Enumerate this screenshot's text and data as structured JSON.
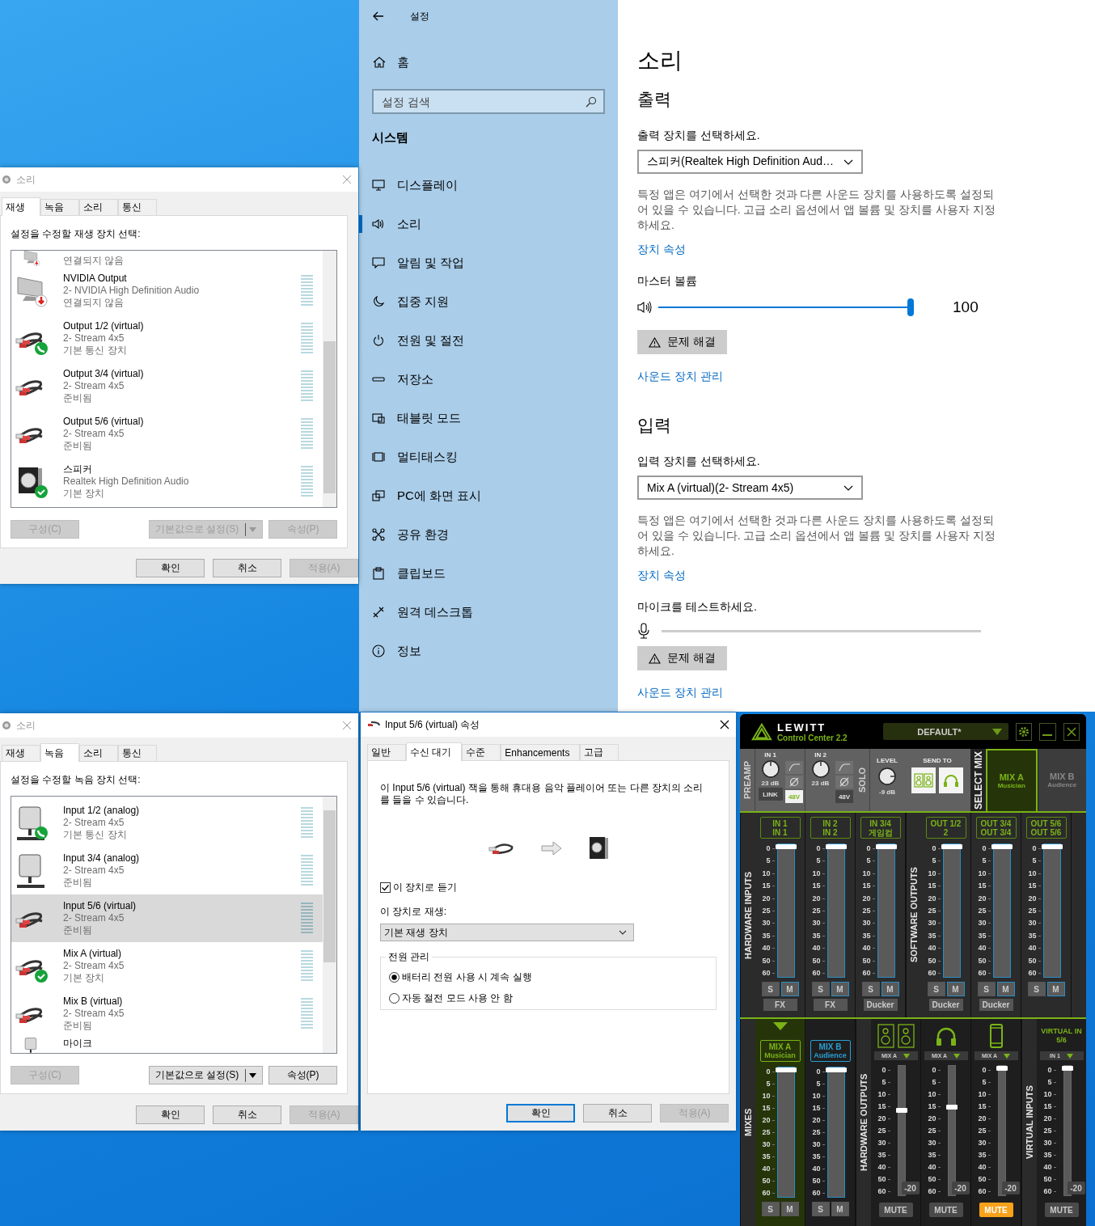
{
  "settings": {
    "title": "설정",
    "home": "홈",
    "search": {
      "placeholder": "설정 검색"
    },
    "section": "시스템",
    "nav": [
      {
        "kind": "display",
        "label": "디스플레이",
        "selected": false
      },
      {
        "kind": "sound",
        "label": "소리",
        "selected": true
      },
      {
        "kind": "notify",
        "label": "알림 및 작업",
        "selected": false
      },
      {
        "kind": "focus",
        "label": "집중 지원",
        "selected": false
      },
      {
        "kind": "power",
        "label": "전원 및 절전",
        "selected": false
      },
      {
        "kind": "storage",
        "label": "저장소",
        "selected": false
      },
      {
        "kind": "tablet",
        "label": "태블릿 모드",
        "selected": false
      },
      {
        "kind": "multitask",
        "label": "멀티태스킹",
        "selected": false
      },
      {
        "kind": "project",
        "label": "PC에 화면 표시",
        "selected": false
      },
      {
        "kind": "share",
        "label": "공유 환경",
        "selected": false
      },
      {
        "kind": "clipboard",
        "label": "클립보드",
        "selected": false
      },
      {
        "kind": "remote",
        "label": "원격 데스크톱",
        "selected": false
      },
      {
        "kind": "info",
        "label": "정보",
        "selected": false
      }
    ],
    "page_title": "소리",
    "sections": [
      {
        "kind": "output",
        "heading": "출력",
        "select_label": "출력 장치를 선택하세요.",
        "device": "스피커(Realtek High Definition Aud…",
        "note": "특정 앱은 여기에서 선택한 것과 다른 사운드 장치를 사용하도록 설정되어 있을 수 있습니다. 고급 소리 옵션에서 앱 볼륨 및 장치를 사용자 지정하세요.",
        "link": "장치 속성",
        "meter_label": "마스터 볼륨",
        "level": 1,
        "reading": "100",
        "troubleshoot": "문제 해결",
        "manage": "사운드 장치 관리"
      },
      {
        "kind": "input",
        "heading": "입력",
        "select_label": "입력 장치를 선택하세요.",
        "device": "Mix A (virtual)(2- Stream 4x5)",
        "note": "특정 앱은 여기에서 선택한 것과 다른 사운드 장치를 사용하도록 설정되어 있을 수 있습니다. 고급 소리 옵션에서 앱 볼륨 및 장치를 사용자 지정하세요.",
        "link": "장치 속성",
        "meter_label": "마이크를 테스트하세요.",
        "level": 0,
        "troubleshoot": "문제 해결",
        "manage": "사운드 장치 관리"
      }
    ]
  },
  "sound_dialogs": [
    {
      "title": "소리",
      "tabs": [
        {
          "label": "재생",
          "selected": true
        },
        {
          "label": "녹음",
          "selected": false
        },
        {
          "label": "소리",
          "selected": false
        },
        {
          "label": "통신",
          "selected": false
        }
      ],
      "instruction": "설정을 수정할 재생 장치 선택:",
      "devices": [
        {
          "kind": "monitor_unplugged",
          "status": "연결되지 않음",
          "selected": false
        },
        {
          "kind": "monitor_unplugged",
          "name": "NVIDIA Output",
          "driver": "2- NVIDIA High Definition Audio",
          "status": "연결되지 않음",
          "selected": false
        },
        {
          "kind": "rca_communication",
          "name": "Output 1/2 (virtual)",
          "driver": "2- Stream 4x5",
          "status": "기본 통신 장치",
          "selected": false
        },
        {
          "kind": "rca",
          "name": "Output 3/4 (virtual)",
          "driver": "2- Stream 4x5",
          "status": "준비됨",
          "selected": false
        },
        {
          "kind": "rca",
          "name": "Output 5/6 (virtual)",
          "driver": "2- Stream 4x5",
          "status": "준비됨",
          "selected": false
        },
        {
          "kind": "speaker_default",
          "name": "스피커",
          "driver": "Realtek High Definition Audio",
          "status": "기본 장치",
          "selected": false
        }
      ],
      "buttons": [
        {
          "kind": "plain",
          "label": "구성(C)",
          "disabled": true
        },
        {
          "kind": "split",
          "label": "기본값으로 설정(S)",
          "disabled": true
        },
        {
          "kind": "plain",
          "label": "속성(P)",
          "disabled": true
        }
      ],
      "footer": [
        {
          "label": "확인",
          "disabled": false
        },
        {
          "label": "취소",
          "disabled": false
        },
        {
          "label": "적용(A)",
          "disabled": true
        }
      ]
    },
    {
      "title": "소리",
      "tabs": [
        {
          "label": "재생",
          "selected": false
        },
        {
          "label": "녹음",
          "selected": true
        },
        {
          "label": "소리",
          "selected": false
        },
        {
          "label": "통신",
          "selected": false
        }
      ],
      "instruction": "설정을 수정할 녹음 장치 선택:",
      "devices": [
        {
          "kind": "mic_communication",
          "name": "Input 1/2 (analog)",
          "driver": "2- Stream 4x5",
          "status": "기본 통신 장치",
          "selected": false
        },
        {
          "kind": "mic",
          "name": "Input 3/4 (analog)",
          "driver": "2- Stream 4x5",
          "status": "준비됨",
          "selected": false
        },
        {
          "kind": "rca",
          "name": "Input 5/6 (virtual)",
          "driver": "2- Stream 4x5",
          "status": "준비됨",
          "selected": true
        },
        {
          "kind": "rca_default",
          "name": "Mix A (virtual)",
          "driver": "2- Stream 4x5",
          "status": "기본 장치",
          "selected": false
        },
        {
          "kind": "rca",
          "name": "Mix B (virtual)",
          "driver": "2- Stream 4x5",
          "status": "준비됨",
          "selected": false
        },
        {
          "kind": "mic",
          "name": "마이크",
          "selected": false
        }
      ],
      "buttons": [
        {
          "kind": "plain",
          "label": "구성(C)",
          "disabled": true
        },
        {
          "kind": "split",
          "label": "기본값으로 설정(S)",
          "disabled": false
        },
        {
          "kind": "plain",
          "label": "속성(P)",
          "disabled": false
        }
      ],
      "footer": [
        {
          "label": "확인",
          "disabled": false
        },
        {
          "label": "취소",
          "disabled": false
        },
        {
          "label": "적용(A)",
          "disabled": true
        }
      ]
    }
  ],
  "properties": {
    "title": "Input 5/6 (virtual) 속성",
    "tabs": [
      {
        "label": "일반",
        "selected": false
      },
      {
        "label": "수신 대기",
        "selected": true
      },
      {
        "label": "수준",
        "selected": false
      },
      {
        "label": "Enhancements",
        "selected": false
      },
      {
        "label": "고급",
        "selected": false
      }
    ],
    "description": "이 Input 5/6 (virtual) 잭을 통해 휴대용 음악 플레이어 또는 다른 장치의 소리를 들을 수 있습니다.",
    "listen": {
      "label": "이 장치로 듣기",
      "checked": true
    },
    "play_label": "이 장치로 재생:",
    "play_device": "기본 재생 장치",
    "power": {
      "label": "전원 관리",
      "options": [
        {
          "label": "배터리 전원 사용 시 계속 실행",
          "selected": true
        },
        {
          "label": "자동 절전 모드 사용 안 함",
          "selected": false
        }
      ]
    },
    "buttons": [
      {
        "label": "확인",
        "default": true,
        "disabled": false
      },
      {
        "label": "취소",
        "default": false,
        "disabled": false
      },
      {
        "label": "적용(A)",
        "default": false,
        "disabled": true
      }
    ]
  },
  "mixer": {
    "brand": "LEWITT",
    "product": "Control Center 2.2",
    "preset": "DEFAULT*",
    "preamp": {
      "label": "PREAMP",
      "inputs": [
        {
          "name": "IN 1",
          "gain": "23 dB",
          "link": "LINK",
          "phantom": "48V",
          "phantom_on": true
        },
        {
          "name": "IN 2",
          "gain": "23 dB",
          "phantom": "48V",
          "phantom_on": false
        }
      ]
    },
    "solo": {
      "label": "SOLO",
      "level_label": "LEVEL",
      "level_reading": "-9 dB",
      "send_label": "SEND TO"
    },
    "select_mix": {
      "label": "SELECT MIX",
      "mixes": [
        {
          "name": "MIX A",
          "sub": "Musician",
          "selected": true
        },
        {
          "name": "MIX B",
          "sub": "Audience",
          "selected": false
        }
      ]
    },
    "upper_groups": [
      {
        "label": "HARDWARE INPUTS",
        "channels": [
          {
            "line1": "IN 1",
            "line2": "IN 1",
            "level": 1,
            "scale": [
              "0",
              "5",
              "10",
              "15",
              "20",
              "25",
              "30",
              "35",
              "40",
              "50",
              "60"
            ],
            "solo": "S",
            "mute": "M",
            "footer": "FX"
          },
          {
            "line1": "IN 2",
            "line2": "IN 2",
            "level": 1,
            "scale": [
              "0",
              "5",
              "10",
              "15",
              "20",
              "25",
              "30",
              "35",
              "40",
              "50",
              "60"
            ],
            "solo": "S",
            "mute": "M",
            "footer": "FX"
          },
          {
            "line1": "IN 3/4",
            "line2": "게임컴",
            "level": 1,
            "scale": [
              "0",
              "5",
              "10",
              "15",
              "20",
              "25",
              "30",
              "35",
              "40",
              "50",
              "60"
            ],
            "solo": "S",
            "mute": "M",
            "footer": "Ducker"
          }
        ]
      },
      {
        "label": "SOFTWARE OUTPUTS",
        "channels": [
          {
            "line1": "OUT 1/2",
            "line2": "2",
            "level": 1,
            "scale": [
              "0",
              "5",
              "10",
              "15",
              "20",
              "25",
              "30",
              "35",
              "40",
              "50",
              "60"
            ],
            "solo": "S",
            "mute": "M",
            "footer": "Ducker"
          },
          {
            "line1": "OUT 3/4",
            "line2": "OUT 3/4",
            "level": 1,
            "scale": [
              "0",
              "5",
              "10",
              "15",
              "20",
              "25",
              "30",
              "35",
              "40",
              "50",
              "60"
            ],
            "solo": "S",
            "mute": "M",
            "footer": "Ducker"
          },
          {
            "line1": "OUT 5/6",
            "line2": "OUT 5/6",
            "level": 1,
            "scale": [
              "0",
              "5",
              "10",
              "15",
              "20",
              "25",
              "30",
              "35",
              "40",
              "50",
              "60"
            ],
            "solo": "S",
            "mute": "M"
          }
        ]
      }
    ],
    "lower_groups": [
      {
        "label": "MIXES",
        "channels": [
          {
            "kind": "mix",
            "name": "MIX A",
            "sub": "Musician",
            "color": "#7ab317",
            "selected": true,
            "level": 1,
            "scale": [
              "0",
              "5",
              "10",
              "15",
              "20",
              "25",
              "30",
              "35",
              "40",
              "50",
              "60"
            ],
            "solo": "S",
            "mute": "M"
          },
          {
            "kind": "mix",
            "name": "MIX B",
            "sub": "Audience",
            "color": "#2a9fd6",
            "selected": false,
            "level": 1,
            "scale": [
              "0",
              "5",
              "10",
              "15",
              "20",
              "25",
              "30",
              "35",
              "40",
              "50",
              "60"
            ],
            "solo": "S",
            "mute": "M"
          }
        ]
      },
      {
        "label": "HARDWARE OUTPUTS",
        "channels": [
          {
            "kind": "speakers",
            "source": "MIX A",
            "level": 0.66,
            "scale": [
              "0",
              "5",
              "10",
              "15",
              "20",
              "25",
              "30",
              "35",
              "40",
              "50",
              "60"
            ],
            "trim": "-20",
            "mute_label": "MUTE",
            "muted": false
          },
          {
            "kind": "headphones",
            "source": "MIX A",
            "level": 0.69,
            "scale": [
              "0",
              "5",
              "10",
              "15",
              "20",
              "25",
              "30",
              "35",
              "40",
              "50",
              "60"
            ],
            "trim": "-20",
            "mute_label": "MUTE",
            "muted": false
          },
          {
            "kind": "phone",
            "source": "MIX A",
            "level": 1,
            "scale": [
              "0",
              "5",
              "10",
              "15",
              "20",
              "25",
              "30",
              "35",
              "40",
              "50",
              "60"
            ],
            "trim": "-20",
            "mute_label": "MUTE",
            "muted": true
          }
        ]
      },
      {
        "label": "VIRTUAL INPUTS",
        "channels": [
          {
            "kind": "virtual",
            "title": "VIRTUAL IN 5/6",
            "source": "IN 1",
            "level": 1,
            "scale": [
              "0",
              "5",
              "10",
              "15",
              "20",
              "25",
              "30",
              "35",
              "40",
              "50",
              "60"
            ],
            "trim": "-20",
            "mute_label": "MUTE",
            "muted": false
          }
        ]
      }
    ]
  }
}
